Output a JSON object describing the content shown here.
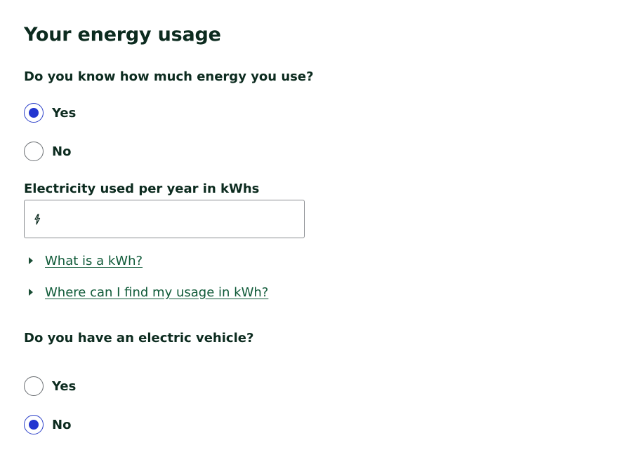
{
  "section": {
    "title": "Your energy usage"
  },
  "usage_question": {
    "label": "Do you know how much energy you use?",
    "options": [
      {
        "label": "Yes",
        "checked": true
      },
      {
        "label": "No",
        "checked": false
      }
    ]
  },
  "electricity_field": {
    "label": "Electricity used per year in kWhs",
    "value": "",
    "placeholder": "",
    "icon": "lightning-bolt-icon"
  },
  "help_links": [
    {
      "label": "What is a kWh?"
    },
    {
      "label": "Where can I find my usage in kWh?"
    }
  ],
  "ev_question": {
    "label": "Do you have an electric vehicle?",
    "options": [
      {
        "label": "Yes",
        "checked": false
      },
      {
        "label": "No",
        "checked": true
      }
    ]
  },
  "colors": {
    "text": "#0c2b1f",
    "link": "#0f5a38",
    "radio_selected": "#2336d0"
  }
}
